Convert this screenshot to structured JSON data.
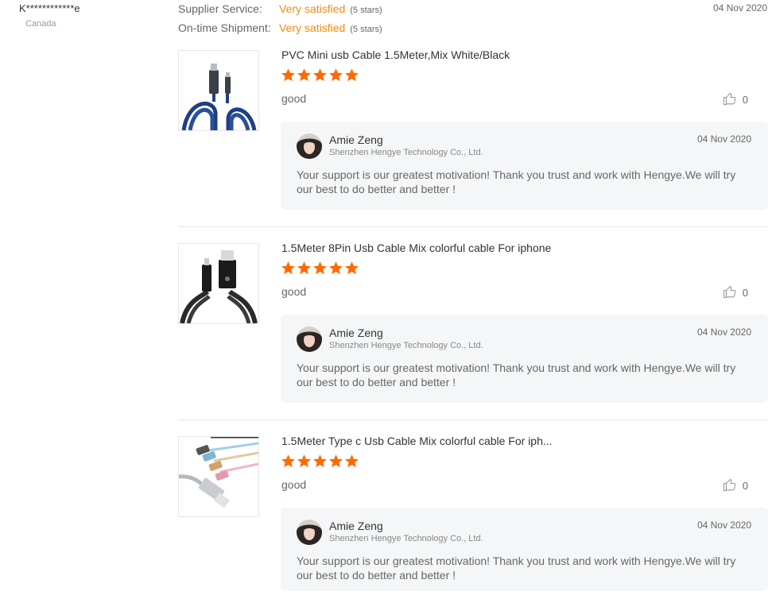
{
  "reviewer": {
    "name": "K************e",
    "country": "Canada"
  },
  "ratings": [
    {
      "label": "Supplier Service:",
      "value": "Very satisfied",
      "note": "(5 stars)"
    },
    {
      "label": "On-time Shipment:",
      "value": "Very satisfied",
      "note": "(5 stars)"
    }
  ],
  "review_date": "04 Nov 2020",
  "accent_color": "#f68a0c",
  "items": [
    {
      "product_name": "PVC Mini usb Cable 1.5Meter,Mix White/Black",
      "rating": 5,
      "comment": "good",
      "likes": "0",
      "reply": {
        "name": "Amie Zeng",
        "company": "Shenzhen Hengye Technology Co., Ltd.",
        "date": "04 Nov 2020",
        "text": "Your support is our greatest motivation! Thank you trust and work with Hengye.We will try our best to do better and better !"
      }
    },
    {
      "product_name": "1.5Meter 8Pin Usb Cable Mix colorful cable For iphone",
      "rating": 5,
      "comment": "good",
      "likes": "0",
      "reply": {
        "name": "Amie Zeng",
        "company": "Shenzhen Hengye Technology Co., Ltd.",
        "date": "04 Nov 2020",
        "text": "Your support is our greatest motivation! Thank you trust and work with Hengye.We will try our best to do better and better !"
      }
    },
    {
      "product_name": "1.5Meter Type c Usb Cable Mix colorful cable For iph...",
      "rating": 5,
      "comment": "good",
      "likes": "0",
      "reply": {
        "name": "Amie Zeng",
        "company": "Shenzhen Hengye Technology Co., Ltd.",
        "date": "04 Nov 2020",
        "text": "Your support is our greatest motivation! Thank you trust and work with Hengye.We will try our best to do better and better !"
      }
    }
  ]
}
